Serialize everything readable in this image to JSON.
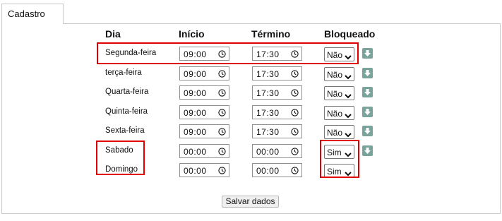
{
  "tab": {
    "label": "Cadastro"
  },
  "table": {
    "headers": {
      "day": "Dia",
      "start": "Início",
      "end": "Término",
      "blocked": "Bloqueado"
    },
    "rows": [
      {
        "day": "Segunda-feira",
        "start": "09:00",
        "end": "17:30",
        "blocked": "Não",
        "download": true
      },
      {
        "day": "terça-feira",
        "start": "09:00",
        "end": "17:30",
        "blocked": "Não",
        "download": true
      },
      {
        "day": "Quarta-feira",
        "start": "09:00",
        "end": "17:30",
        "blocked": "Não",
        "download": true
      },
      {
        "day": "Quinta-feira",
        "start": "09:00",
        "end": "17:30",
        "blocked": "Não",
        "download": true
      },
      {
        "day": "Sexta-feira",
        "start": "09:00",
        "end": "17:30",
        "blocked": "Não",
        "download": true
      },
      {
        "day": "Sabado",
        "start": "00:00",
        "end": "00:00",
        "blocked": "Sim",
        "download": true
      },
      {
        "day": "Domingo",
        "start": "00:00",
        "end": "00:00",
        "blocked": "Sim",
        "download": false
      }
    ]
  },
  "save_button": {
    "label": "Salvar dados"
  },
  "icons": {
    "time": "clock-icon",
    "dropdown": "chevron-down-icon",
    "action": "download-arrow-icon"
  },
  "colors": {
    "highlight": "#e00000",
    "action_icon": "#7aa39b"
  }
}
